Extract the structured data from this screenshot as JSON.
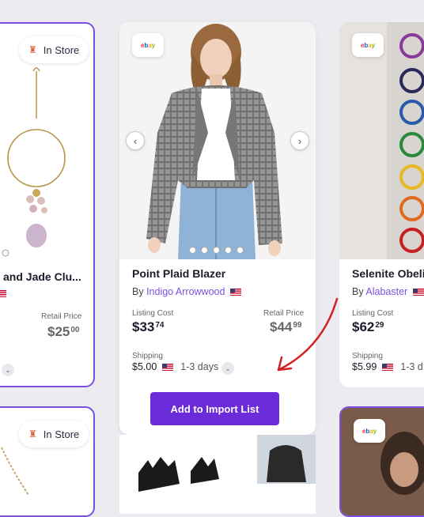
{
  "cards": {
    "left": {
      "store_badge": "In Store",
      "title": "and Jade Clu...",
      "retail_label": "Retail Price",
      "retail_price_main": "$25",
      "retail_price_cents": "00"
    },
    "center": {
      "channel": "ebay",
      "title": "Point Plaid Blazer",
      "by_prefix": "By",
      "vendor": "Indigo Arrowwood",
      "listing_label": "Listing Cost",
      "listing_price_main": "$33",
      "listing_price_cents": "74",
      "retail_label": "Retail Price",
      "retail_price_main": "$44",
      "retail_price_cents": "99",
      "shipping_label": "Shipping",
      "shipping_price": "$5.00",
      "shipping_days": "1-3 days",
      "import_button": "Add to Import List",
      "slide_count": 5
    },
    "right": {
      "channel": "ebay",
      "title": "Selenite Obeli",
      "by_prefix": "By",
      "vendor": "Alabaster",
      "listing_label": "Listing Cost",
      "listing_price_main": "$62",
      "listing_price_cents": "29",
      "shipping_label": "Shipping",
      "shipping_price": "$5.99",
      "shipping_days": "1-3 d"
    },
    "bottom_left": {
      "store_badge": "In Store"
    },
    "bottom_right": {
      "channel": "ebay"
    }
  },
  "colors": {
    "accent": "#7b50e0",
    "button": "#6c2bd9",
    "annotation": "#d42020"
  }
}
